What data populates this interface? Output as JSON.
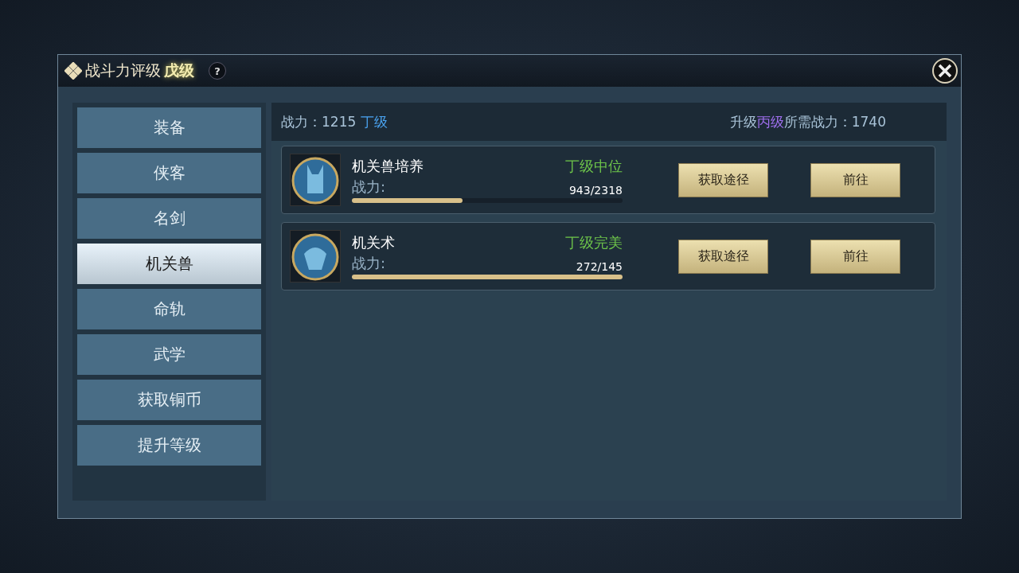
{
  "window": {
    "title": "战斗力评级",
    "rank": "戊级",
    "help": "?"
  },
  "sidebar": {
    "items": [
      {
        "label": "装备",
        "selected": false
      },
      {
        "label": "侠客",
        "selected": false
      },
      {
        "label": "名剑",
        "selected": false
      },
      {
        "label": "机关兽",
        "selected": true
      },
      {
        "label": "命轨",
        "selected": false
      },
      {
        "label": "武学",
        "selected": false
      },
      {
        "label": "获取铜币",
        "selected": false
      },
      {
        "label": "提升等级",
        "selected": false
      }
    ]
  },
  "summary": {
    "current": [
      {
        "text": "战力：1215 ",
        "color": "#a9c3d8"
      },
      {
        "text": "丁级",
        "color": "#4aa3f0"
      }
    ],
    "target": [
      {
        "text": "升级",
        "color": "#a9c3d8"
      },
      {
        "text": "丙级",
        "color": "#a070f0"
      },
      {
        "text": "所需战力：1740",
        "color": "#a9c3d8"
      }
    ]
  },
  "rows": [
    {
      "name": "机关兽培养",
      "grade": "丁级中位",
      "power_label": "战力:",
      "reading": "943/2318",
      "level": 0.41,
      "buttons": [
        "获取途径",
        "前往"
      ]
    },
    {
      "name": "机关术",
      "grade": "丁级完美",
      "power_label": "战力:",
      "reading": "272/145",
      "level": 1,
      "buttons": [
        "获取途径",
        "前往"
      ]
    }
  ]
}
